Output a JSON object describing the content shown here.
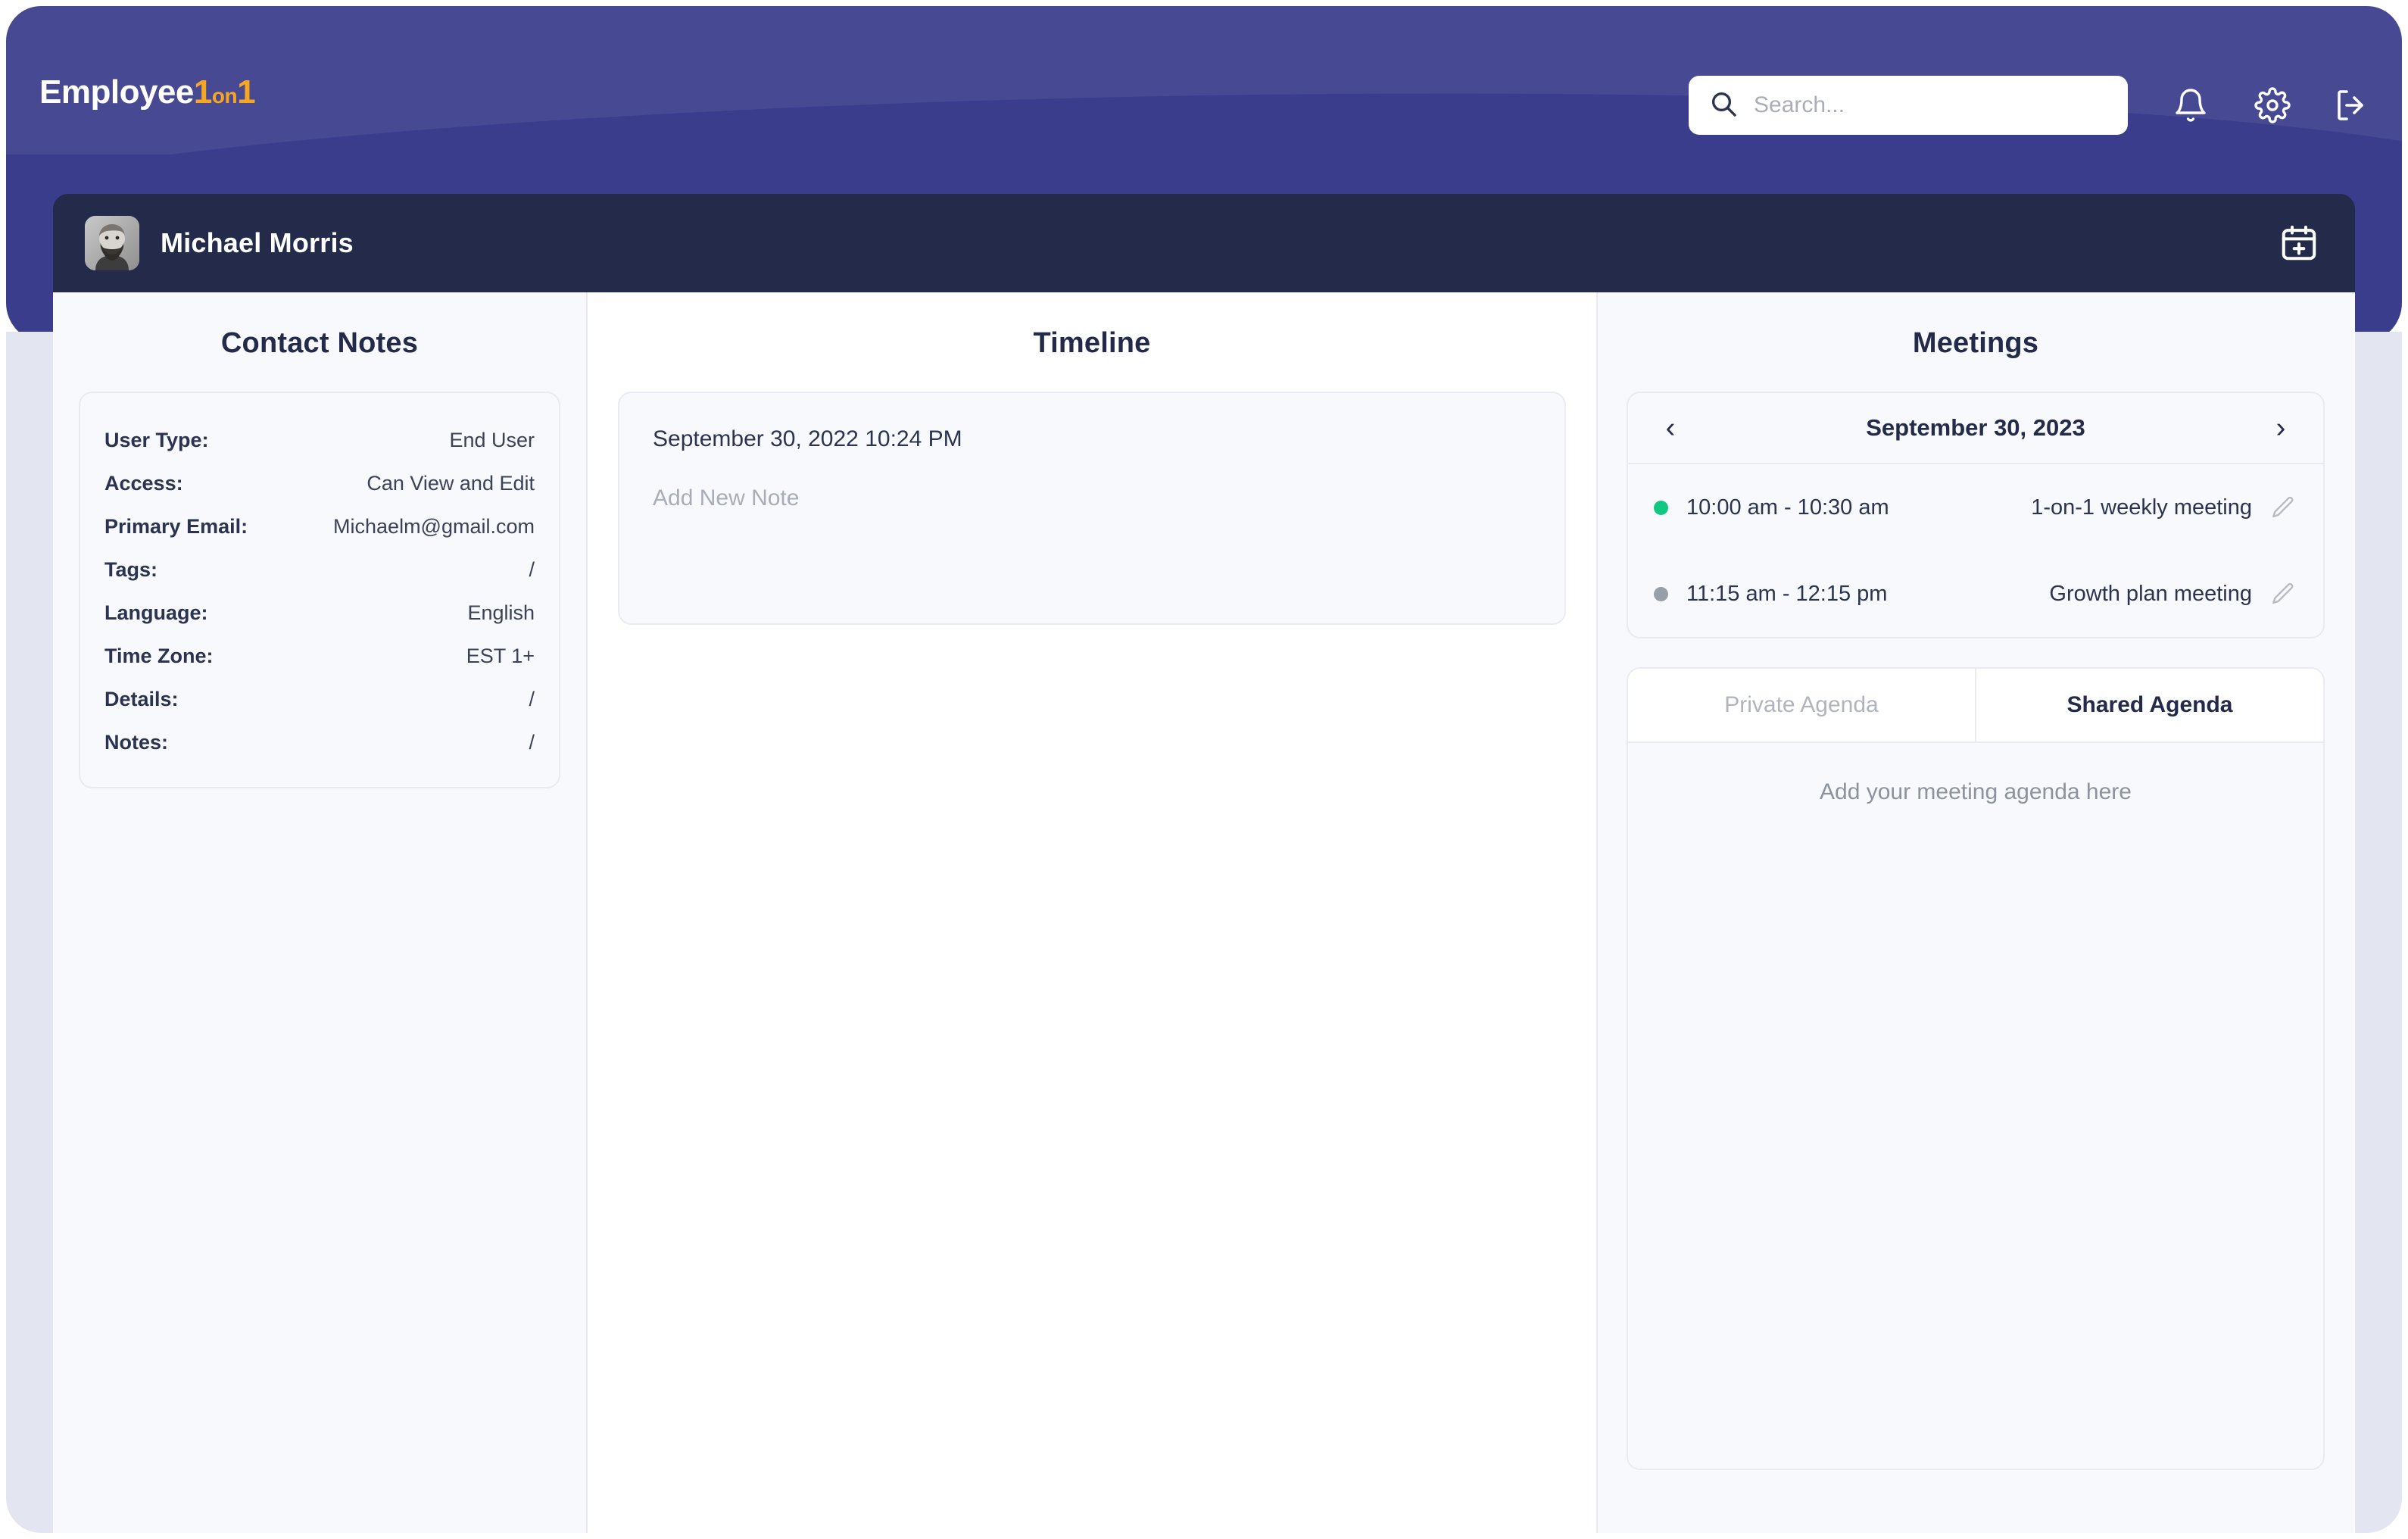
{
  "app": {
    "logo_main": "Employee",
    "logo_one_a": "1",
    "logo_on": "on",
    "logo_one_b": "1",
    "accent_color": "#f5a623",
    "header_color": "#474a93",
    "panel_color": "#3a3c8c"
  },
  "header": {
    "search_placeholder": "Search...",
    "search_value": "",
    "icons": {
      "search": "search-icon",
      "bell": "bell-icon",
      "gear": "gear-icon",
      "logout": "logout-icon"
    }
  },
  "profile": {
    "name": "Michael Morris",
    "avatar": "user-avatar",
    "action_icon": "calendar-plus-icon"
  },
  "columns": {
    "left_title": "Contact Notes",
    "middle_title": "Timeline",
    "right_title": "Meetings"
  },
  "contact_notes": {
    "rows": [
      {
        "label": "User Type:",
        "value": "End User"
      },
      {
        "label": "Access:",
        "value": "Can View and Edit"
      },
      {
        "label": "Primary Email:",
        "value": "Michaelm@gmail.com"
      },
      {
        "label": "Tags:",
        "value": "/"
      },
      {
        "label": "Language:",
        "value": "English"
      },
      {
        "label": "Time Zone:",
        "value": "EST 1+"
      },
      {
        "label": "Details:",
        "value": "/"
      },
      {
        "label": "Notes:",
        "value": "/"
      }
    ]
  },
  "timeline": {
    "entry_date": "September 30, 2022 10:24 PM",
    "note_placeholder": "Add New Note",
    "note_value": ""
  },
  "meetings": {
    "date": "September 30, 2023",
    "prev_label": "‹",
    "next_label": "›",
    "items": [
      {
        "time": "10:00 am - 10:30 am",
        "title": "1-on-1 weekly meeting",
        "status_color": "#12c780",
        "edit_icon": "pencil-icon"
      },
      {
        "time": "11:15 am - 12:15 pm",
        "title": "Growth plan meeting",
        "status_color": "#9a9ea8",
        "edit_icon": "pencil-icon"
      }
    ]
  },
  "agenda": {
    "tab_private": "Private Agenda",
    "tab_shared": "Shared Agenda",
    "active_tab": "Shared Agenda",
    "placeholder": "Add your meeting agenda here"
  }
}
